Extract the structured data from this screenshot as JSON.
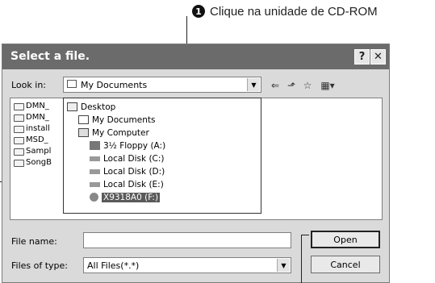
{
  "annotation": {
    "number": "1",
    "text": "Clique na unidade de CD-ROM"
  },
  "dialog": {
    "title": "Select a file.",
    "help_label": "?",
    "close_label": "✕",
    "look_in_label": "Look in:",
    "look_in_value": "My Documents",
    "files": [
      "DMN_",
      "DMN_",
      "install",
      "MSD_",
      "Sampl",
      "SongB"
    ],
    "dropdown_items": [
      {
        "label": "Desktop",
        "icon": "desktop-icon"
      },
      {
        "label": "My Documents",
        "icon": "folder-icon"
      },
      {
        "label": "My Computer",
        "icon": "computer-icon"
      },
      {
        "label": "3½ Floppy (A:)",
        "icon": "floppy-icon"
      },
      {
        "label": "Local Disk (C:)",
        "icon": "disk-icon"
      },
      {
        "label": "Local Disk (D:)",
        "icon": "disk-icon"
      },
      {
        "label": "Local Disk (E:)",
        "icon": "disk-icon"
      },
      {
        "label": "X9318A0 (F:)",
        "icon": "cdrom-icon",
        "selected": true
      }
    ],
    "file_name_label": "File name:",
    "file_name_value": "",
    "files_of_type_label": "Files of type:",
    "files_of_type_value": "All Files(*.*)",
    "open_label": "Open",
    "cancel_label": "Cancel"
  }
}
